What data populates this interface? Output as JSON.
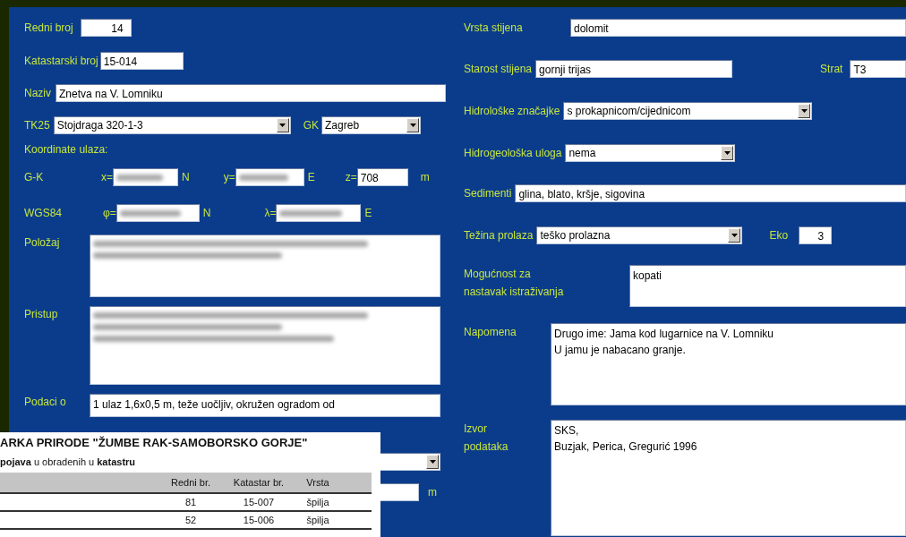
{
  "left": {
    "redni_broj": {
      "label": "Redni broj",
      "value": "14"
    },
    "katastarski_broj": {
      "label": "Katastarski broj",
      "value": "15-014"
    },
    "naziv": {
      "label": "Naziv",
      "value": "Znetva na V. Lomniku"
    },
    "tk25": {
      "label": "TK25",
      "value": "Stojdraga 320-1-3"
    },
    "gk": {
      "label": "GK",
      "value": "Zagreb"
    },
    "coordinates_heading": "Koordinate ulaza:",
    "gk_coords": {
      "label": "G-K",
      "x_label": "x=",
      "x_unit": "N",
      "y_label": "y=",
      "y_unit": "E",
      "z_label": "z=",
      "z_value": "708",
      "z_unit": "m",
      "redacted": true
    },
    "wgs84_coords": {
      "label": "WGS84",
      "phi_label": "φ=",
      "phi_unit": "N",
      "lambda_label": "λ=",
      "lambda_unit": "E",
      "redacted": true
    },
    "polozaj": {
      "label": "Položaj",
      "redacted": true
    },
    "pristup": {
      "label": "Pristup",
      "redacted": true
    },
    "podaci": {
      "label": "Podaci o",
      "value": "1 ulaz 1,6x0,5 m, teže uočljiv, okružen ogradom od"
    },
    "lower_unit": "m"
  },
  "right": {
    "vrsta_stijena": {
      "label": "Vrsta stijena",
      "value": "dolomit"
    },
    "starost_stijena": {
      "label": "Starost stijena",
      "value": "gornji trijas"
    },
    "strat": {
      "label": "Strat",
      "value": "T3"
    },
    "hidroloske": {
      "label": "Hidrološke značajke",
      "value": "s prokapnicom/cijednicom"
    },
    "hidrogeoloska": {
      "label": "Hidrogeološka uloga",
      "value": "nema"
    },
    "sedimenti": {
      "label": "Sedimenti",
      "value": "glina, blato, kršje, sigovina"
    },
    "tezina": {
      "label": "Težina prolaza",
      "value": "teško prolazna"
    },
    "eko": {
      "label": "Eko",
      "value": "3"
    },
    "mogucnost": {
      "label_lines": [
        "Mogućnost za",
        "nastavak istraživanja"
      ],
      "value": "kopati"
    },
    "napomena": {
      "label": "Napomena",
      "lines": [
        "Drugo ime: Jama kod lugarnice na V. Lomniku",
        "U jamu je nabacano granje."
      ]
    },
    "izvor": {
      "label_lines": [
        "Izvor",
        "podataka"
      ],
      "lines": [
        "SKS,",
        "Buzjak, Perica, Gregurić 1996"
      ]
    }
  },
  "document": {
    "title": "ARKA PRIRODE \"ŽUMBE RAK-SAMOBORSKO GORJE\"",
    "subtitle": "**pojava** u obradenih u **katastru**",
    "columns": [
      "Redni br.",
      "Katastar br.",
      "Vrsta"
    ],
    "rows": [
      [
        "81",
        "15-007",
        "špilja"
      ],
      [
        "52",
        "15-006",
        "špilja"
      ]
    ]
  }
}
